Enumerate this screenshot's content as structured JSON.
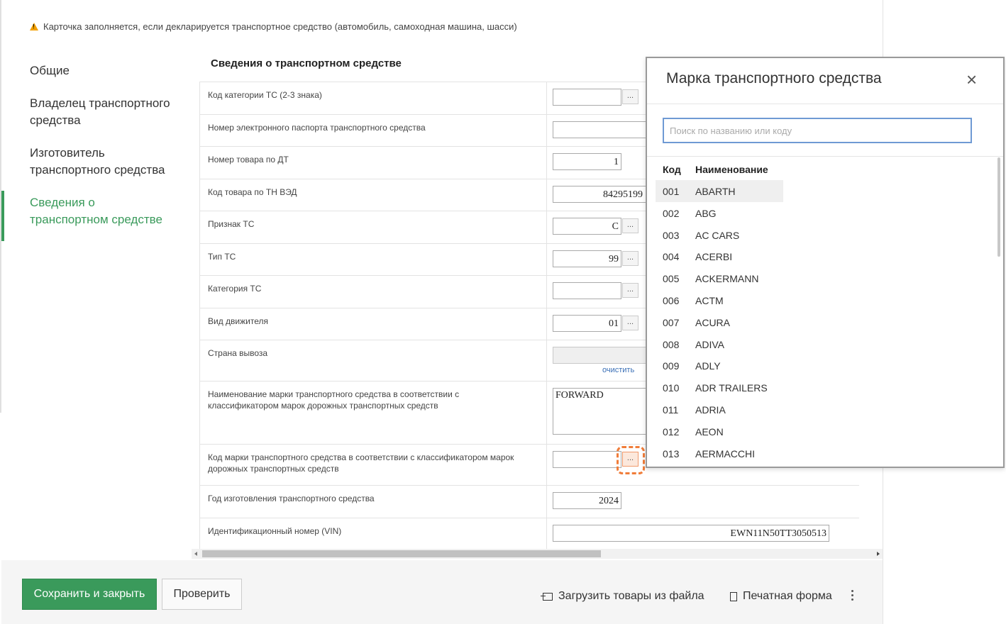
{
  "notice": "Карточка заполняется, если декларируется транспортное средство (автомобиль, самоходная машина, шасси)",
  "nav": {
    "general": "Общие",
    "owner": "Владелец транспортного средства",
    "manufacturer": "Изготовитель транспортного средства",
    "vehicle_info": "Сведения о транспортном средстве"
  },
  "section_title": "Сведения о транспортном средстве",
  "fields": {
    "category_code": {
      "label": "Код категории ТС (2-3 знака)",
      "value": ""
    },
    "epassport": {
      "label": "Номер электронного паспорта транспортного средства",
      "value": ""
    },
    "item_no": {
      "label": "Номер товара по ДТ",
      "value": "1"
    },
    "hs_code": {
      "label": "Код товара по ТН ВЭД",
      "value": "84295199"
    },
    "attribute": {
      "label": "Признак ТС",
      "value": "C"
    },
    "type": {
      "label": "Тип ТС",
      "value": "99"
    },
    "category": {
      "label": "Категория ТС",
      "value": ""
    },
    "engine": {
      "label": "Вид движителя",
      "value": "01"
    },
    "export_country": {
      "label": "Страна вывоза",
      "value": "",
      "clear_link": "очистить"
    },
    "brand_name": {
      "label": "Наименование марки транспортного средства в соответствии с классификатором марок дорожных транспортных средств",
      "value": "FORWARD"
    },
    "brand_code": {
      "label": "Код марки транспортного средства в соответствии с классификатором марок дорожных транспортных средств",
      "value": ""
    },
    "year": {
      "label": "Год изготовления транспортного средства",
      "value": "2024"
    },
    "vin": {
      "label": "Идентификационный номер (VIN)",
      "value": "EWN11N50TT3050513"
    }
  },
  "dots_label": "...",
  "footer": {
    "save": "Сохранить и закрыть",
    "check": "Проверить",
    "upload": "Загрузить товары из файла",
    "print": "Печатная форма"
  },
  "modal": {
    "title": "Марка транспортного средства",
    "close": "×",
    "search_placeholder": "Поиск по названию или коду",
    "col_code": "Код",
    "col_name": "Наименование",
    "items": [
      {
        "code": "001",
        "name": "ABARTH"
      },
      {
        "code": "002",
        "name": "ABG"
      },
      {
        "code": "003",
        "name": "AC CARS"
      },
      {
        "code": "004",
        "name": "ACERBI"
      },
      {
        "code": "005",
        "name": "ACKERMANN"
      },
      {
        "code": "006",
        "name": "ACTM"
      },
      {
        "code": "007",
        "name": "ACURA"
      },
      {
        "code": "008",
        "name": "ADIVA"
      },
      {
        "code": "009",
        "name": "ADLY"
      },
      {
        "code": "010",
        "name": "ADR TRAILERS"
      },
      {
        "code": "011",
        "name": "ADRIA"
      },
      {
        "code": "012",
        "name": "AEON"
      },
      {
        "code": "013",
        "name": "AERMACCHI"
      }
    ]
  },
  "colors": {
    "accent": "#3a9a5b",
    "highlight": "#f07d3a",
    "link": "#3a6fb6"
  }
}
